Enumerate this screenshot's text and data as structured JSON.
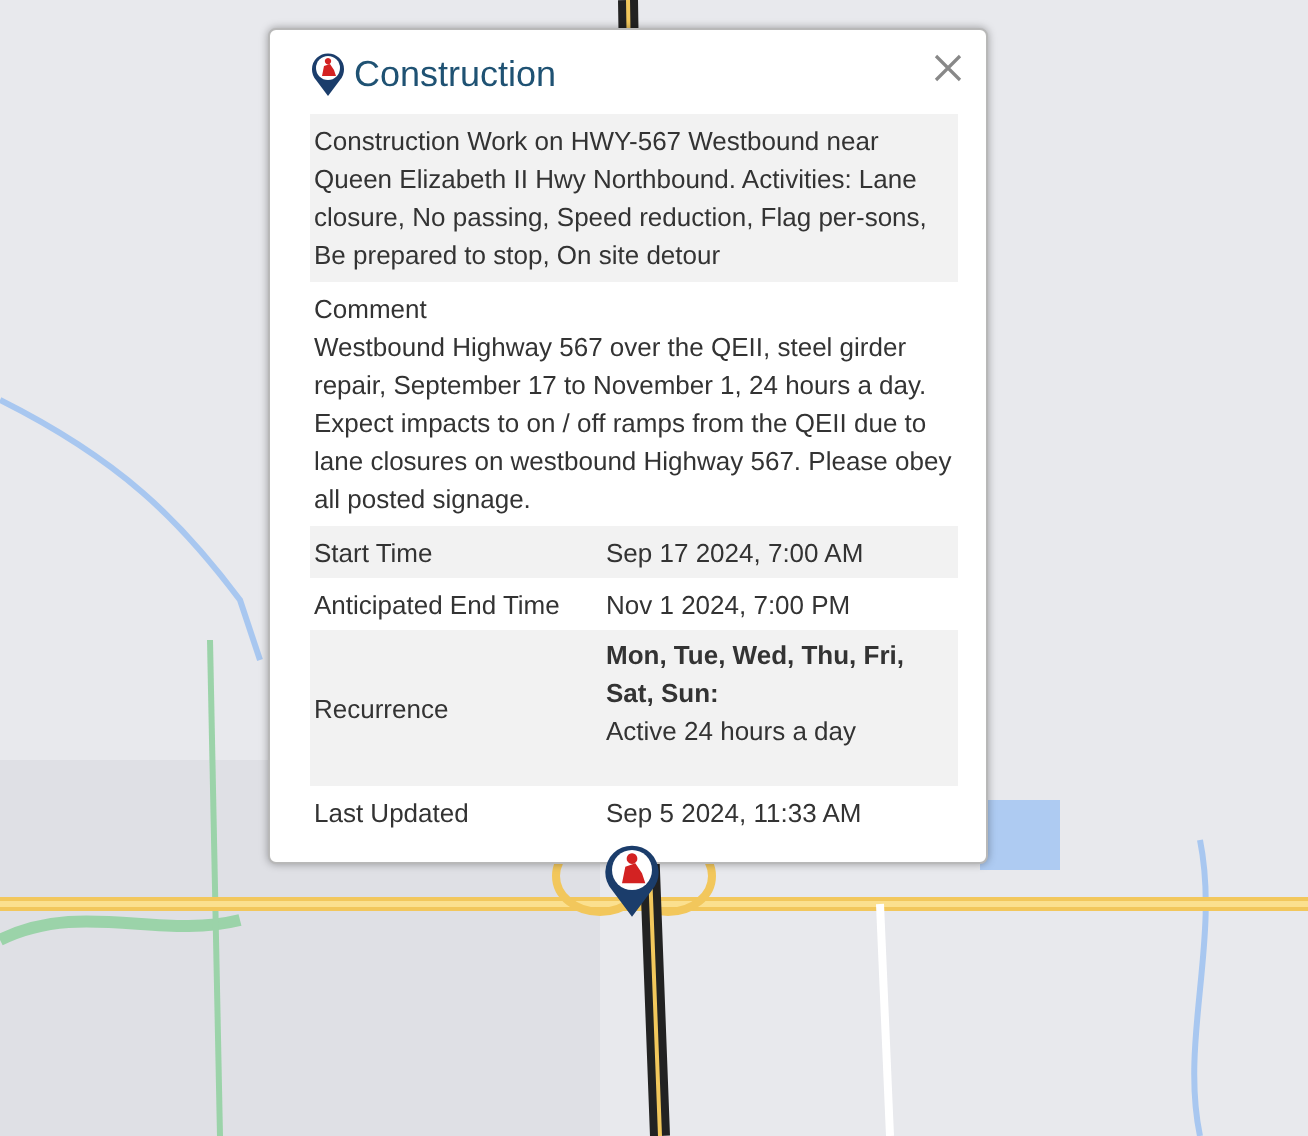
{
  "popup": {
    "title": "Construction",
    "description": "Construction Work on HWY-567 Westbound near Queen Elizabeth II Hwy Northbound. Activities: Lane closure, No passing, Speed reduction, Flag per-sons, Be prepared to stop, On site detour",
    "comment": {
      "label": "Comment",
      "text": "Westbound Highway 567 over the QEII, steel girder repair, September 17 to November 1, 24 hours a day. Expect impacts to on / off ramps from the QEII due to lane closures on westbound Highway 567. Please obey all posted signage."
    },
    "details": [
      {
        "kind": "plain",
        "label": "Start Time",
        "value": "Sep 17 2024, 7:00 AM"
      },
      {
        "kind": "plain",
        "label": "Anticipated End Time",
        "value": "Nov 1 2024, 7:00 PM"
      },
      {
        "kind": "recurrence",
        "label": "Recurrence",
        "days": "Mon, Tue, Wed, Thu, Fri, Sat, Sun:",
        "hours": "Active 24 hours a day"
      },
      {
        "kind": "plain",
        "label": "Last Updated",
        "value": "Sep 5 2024, 11:33 AM"
      }
    ]
  }
}
